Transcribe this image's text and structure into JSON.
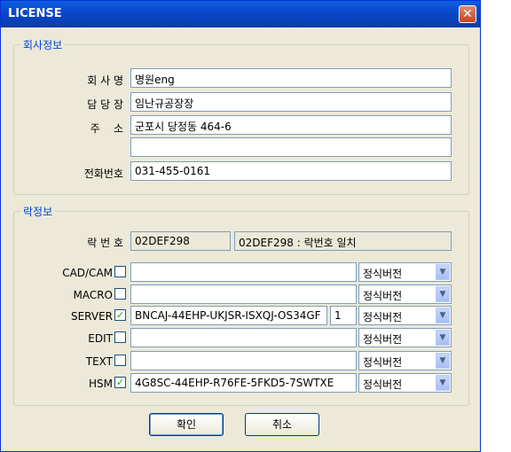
{
  "window": {
    "title": "LICENSE",
    "close_glyph": "✕"
  },
  "company": {
    "group_label": "회사정보",
    "rows": [
      {
        "label": "회 사 명",
        "value": "명원eng"
      },
      {
        "label": "담 당 장",
        "value": "임난규공장장"
      },
      {
        "label": "주    소",
        "value": "군포시 당정동 464-6"
      },
      {
        "label": "",
        "value": ""
      },
      {
        "label": "전화번호",
        "value": "031-455-0161"
      }
    ]
  },
  "lock": {
    "group_label": "락정보",
    "lock_number_label": "락 번 호",
    "lock_number": "02DEF298",
    "lock_status": "02DEF298 : 락번호 일치",
    "modules": [
      {
        "label": "CAD/CAM",
        "checked": false,
        "key": "",
        "count": "",
        "version": "정식버전"
      },
      {
        "label": "MACRO",
        "checked": false,
        "key": "",
        "count": "",
        "version": "정식버전"
      },
      {
        "label": "SERVER",
        "checked": true,
        "key": "BNCAJ-44EHP-UKJSR-ISXQJ-OS34GF",
        "count": "1",
        "version": "정식버전"
      },
      {
        "label": "EDIT",
        "checked": false,
        "key": "",
        "count": "",
        "version": "정식버전"
      },
      {
        "label": "TEXT",
        "checked": false,
        "key": "",
        "count": "",
        "version": "정식버전"
      },
      {
        "label": "HSM",
        "checked": true,
        "key": "4G8SC-44EHP-R76FE-5FKD5-7SWTXE",
        "count": "",
        "version": "정식버전"
      }
    ]
  },
  "buttons": {
    "ok": "확인",
    "cancel": "취소"
  }
}
